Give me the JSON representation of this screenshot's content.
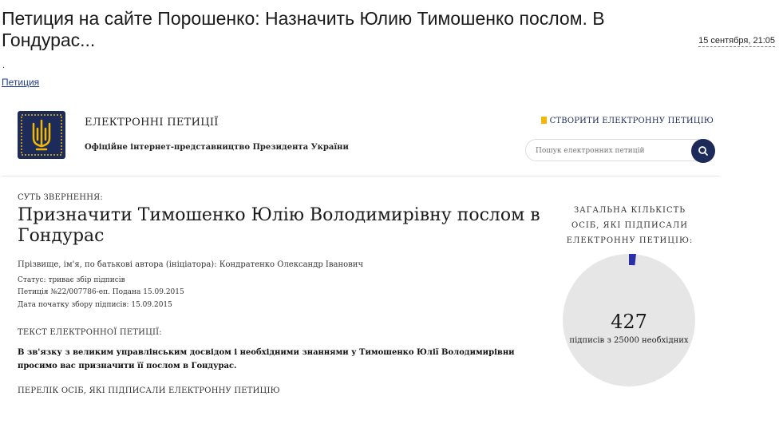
{
  "article": {
    "title": "Петиция на сайте Порошенко: Назначить Юлию Тимошенко послом. В Гондурас...",
    "date": "15 сентября, 21:05",
    "dot": ".",
    "tag": "Петиция"
  },
  "site": {
    "title": "ЕЛЕКТРОННІ ПЕТИЦІЇ",
    "subtitle": "Офіційне інтернет-представництво Президента України",
    "create_label": "СТВОРИТИ ЕЛЕКТРОННУ ПЕТИЦІЮ",
    "search_placeholder": "Пошук електронних петицій"
  },
  "petition": {
    "essence_label": "СУТЬ ЗВЕРНЕННЯ:",
    "title": "Призначити Тимошенко Юлію Володимирівну послом в Гондурас",
    "author": "Прізвище, ім'я, по батькові автора (ініціатора): Кондратенко Олександр Іванович",
    "status": "Статус: триває збір підписів",
    "number": "Петиція №22/007786-еп. Подана 15.09.2015",
    "start_date": "Дата початку збору підписів: 15.09.2015",
    "text_label": "ТЕКСТ ЕЛЕКТРОННОЇ ПЕТИЦІЇ:",
    "text": "В зв'язку з великим управлінським досвідом і необхідними знаннями у Тимошенко Юлії Володимирівни просимо вас призначити її послом в Гондурас.",
    "list_label": "ПЕРЕЛІК ОСІБ, ЯКІ ПІДПИСАЛИ ЕЛЕКТРОННУ ПЕТИЦІЮ"
  },
  "counter": {
    "heading": "ЗАГАЛЬНА КІЛЬКІСТЬ ОСІБ, ЯКІ ПІДПИСАЛИ ЕЛЕКТРОННУ ПЕТИЦІЮ:",
    "count": "427",
    "sub": "підписів з 25000 необхідних",
    "signed": 427,
    "required": 25000
  },
  "colors": {
    "navy": "#1c2b5a",
    "gold": "#f2b705",
    "gauge_bg": "#e6e6e6",
    "gauge_fill": "#2a2fa8"
  }
}
